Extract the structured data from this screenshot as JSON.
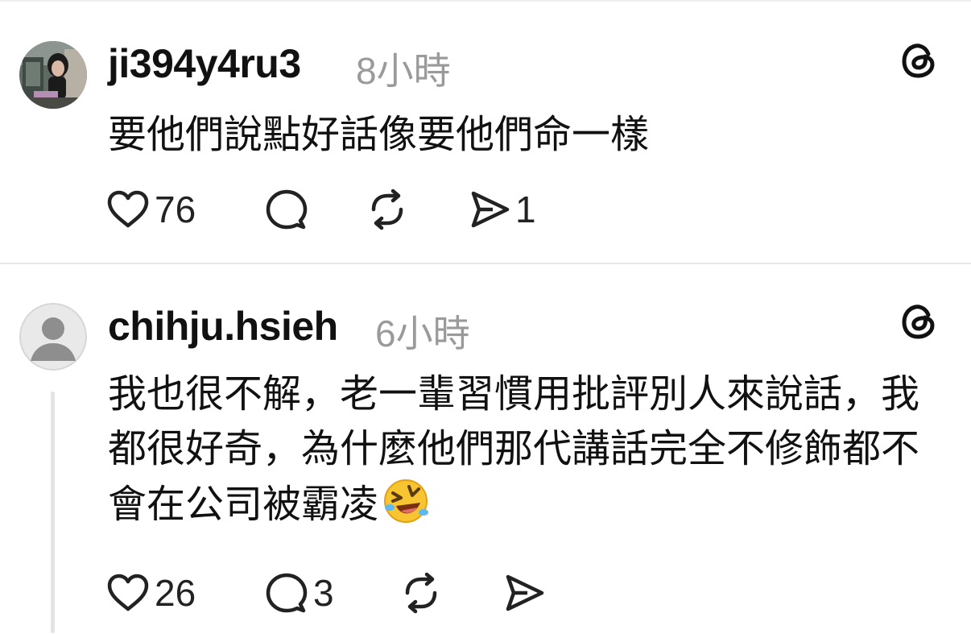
{
  "posts": [
    {
      "username": "ji394y4ru3",
      "time": "8小時",
      "text": "要他們說點好話像要他們命一樣",
      "likes": "76",
      "replies": "",
      "shares": "1"
    },
    {
      "username": "chihju.hsieh",
      "time": "6小時",
      "text": "我也很不解，老一輩習慣用批評別人來說話，我都很好奇，為什麼他們那代講話完全不修飾都不會在公司被霸凌",
      "likes": "26",
      "replies": "3",
      "shares": ""
    }
  ],
  "icons": {
    "like": "heart-icon",
    "reply": "speech-bubble-icon",
    "repost": "repost-icon",
    "share": "send-icon",
    "brand": "threads-logo-icon",
    "emoji": "rolling-on-floor-laughing-emoji"
  },
  "colors": {
    "text": "#111111",
    "muted": "#9a9a9a",
    "divider": "#e8e8e8",
    "thread_line": "#e3e3e3"
  }
}
